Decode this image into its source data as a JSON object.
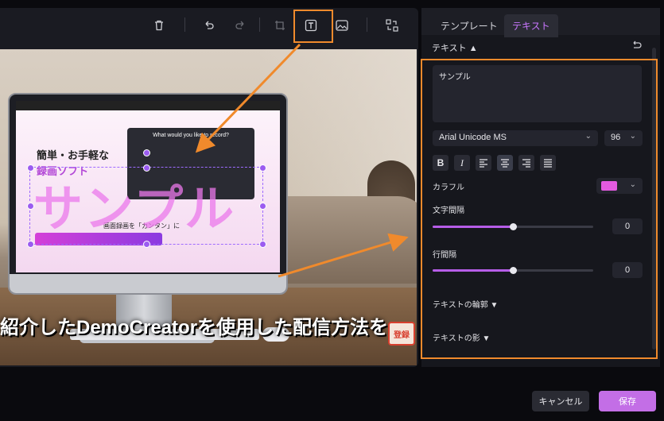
{
  "toolbar": {
    "icons": [
      "trash-icon",
      "undo-icon",
      "redo-icon",
      "crop-icon",
      "text-icon",
      "image-icon",
      "swap-icon"
    ]
  },
  "canvas": {
    "overlay_text": "サンプル",
    "caption": "紹介したDemoCreatorを使用した配信方法を",
    "stamp_text": "登録",
    "screen": {
      "title_line1": "簡単・お手軽な",
      "title_line2": "録画ソフト",
      "subtitle": "画面録画を「カンタン」に",
      "dialog_title": "What would you like to record?"
    }
  },
  "panel": {
    "tabs": [
      {
        "label": "テンプレート",
        "active": false
      },
      {
        "label": "テキスト",
        "active": true
      }
    ],
    "section_title": "テキスト ▲",
    "text_value": "サンプル",
    "font_family": "Arial Unicode MS",
    "font_size": "96",
    "color_label": "カラフル",
    "color_swatch": "#e45ae0",
    "letter_spacing_label": "文字間隔",
    "letter_spacing_value": "0",
    "letter_spacing_level": 0.5,
    "line_spacing_label": "行間隔",
    "line_spacing_value": "0",
    "line_spacing_level": 0.5,
    "outline_label": "テキストの輪郭 ▼",
    "shadow_label": "テキストの影 ▼"
  },
  "footer": {
    "cancel": "キャンセル",
    "save": "保存"
  },
  "colors": {
    "accent": "#c36ee6",
    "annotation": "#f08a2c"
  }
}
